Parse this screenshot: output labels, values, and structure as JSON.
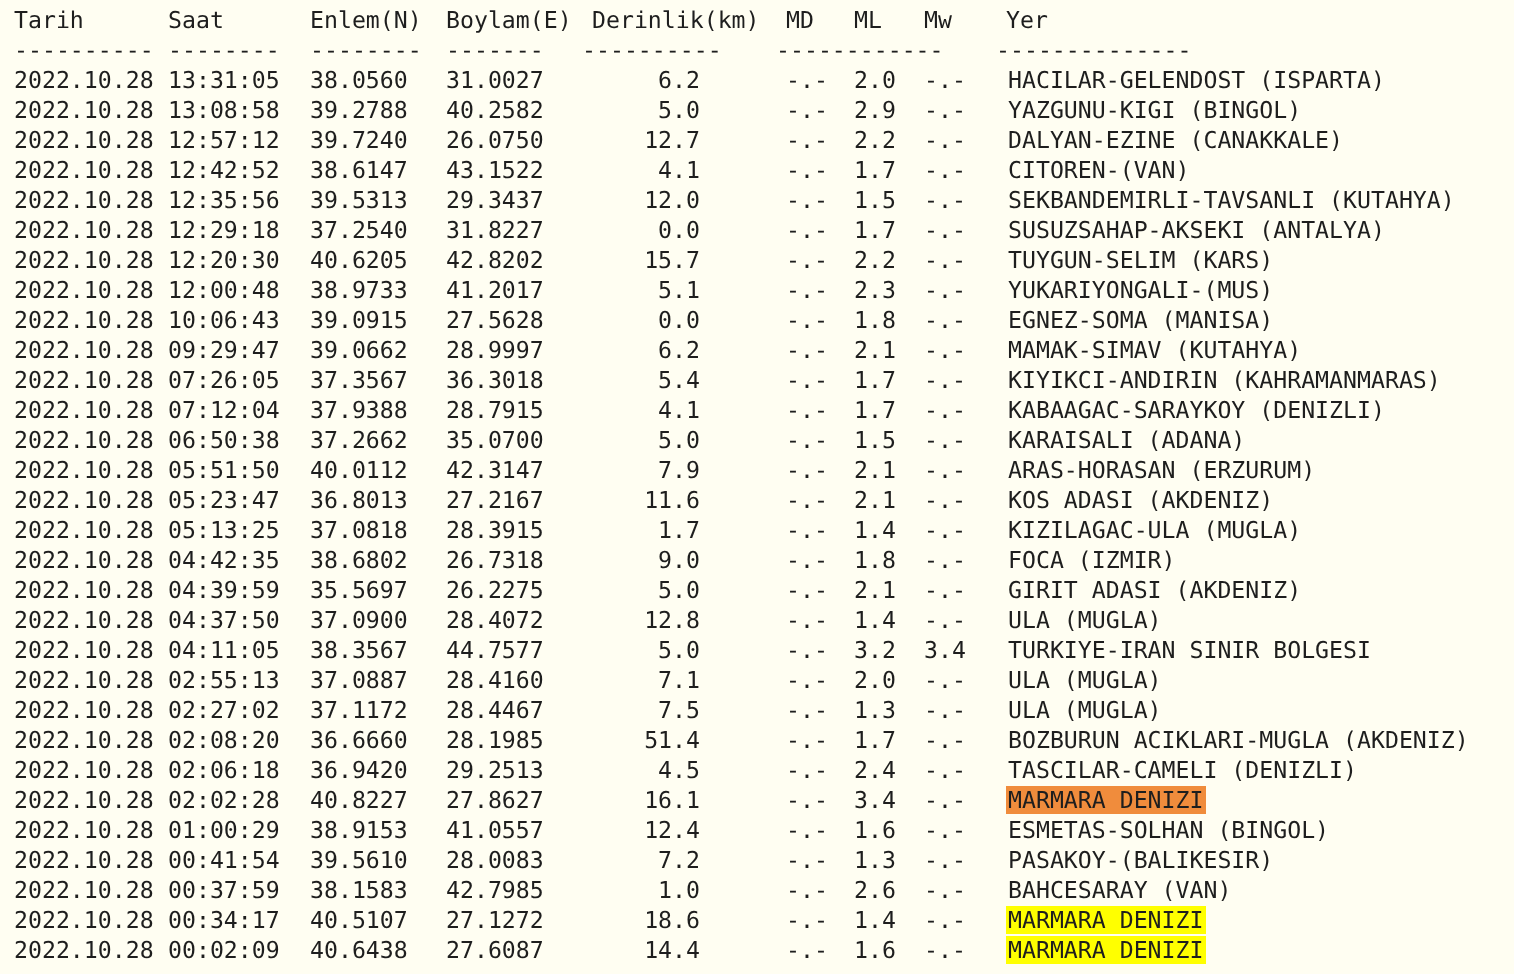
{
  "header": {
    "columns": [
      "Tarih",
      "Saat",
      "Enlem(N)",
      "Boylam(E)",
      "Derinlik(km)",
      "MD",
      "ML",
      "Mw",
      "Yer"
    ],
    "rules": [
      "----------",
      "--------",
      "--------",
      "-------",
      "----------",
      "------------",
      "--------------"
    ]
  },
  "rows": [
    {
      "date": "2022.10.28",
      "time": "13:31:05",
      "lat": "38.0560",
      "lon": "31.0027",
      "depth": "6.2",
      "md": "-.-",
      "ml": "2.0",
      "mw": "-.-",
      "location": "HACILAR-GELENDOST (ISPARTA)"
    },
    {
      "date": "2022.10.28",
      "time": "13:08:58",
      "lat": "39.2788",
      "lon": "40.2582",
      "depth": "5.0",
      "md": "-.-",
      "ml": "2.9",
      "mw": "-.-",
      "location": "YAZGUNU-KIGI (BINGOL)"
    },
    {
      "date": "2022.10.28",
      "time": "12:57:12",
      "lat": "39.7240",
      "lon": "26.0750",
      "depth": "12.7",
      "md": "-.-",
      "ml": "2.2",
      "mw": "-.-",
      "location": "DALYAN-EZINE (CANAKKALE)"
    },
    {
      "date": "2022.10.28",
      "time": "12:42:52",
      "lat": "38.6147",
      "lon": "43.1522",
      "depth": "4.1",
      "md": "-.-",
      "ml": "1.7",
      "mw": "-.-",
      "location": "CITOREN-(VAN)"
    },
    {
      "date": "2022.10.28",
      "time": "12:35:56",
      "lat": "39.5313",
      "lon": "29.3437",
      "depth": "12.0",
      "md": "-.-",
      "ml": "1.5",
      "mw": "-.-",
      "location": "SEKBANDEMIRLI-TAVSANLI (KUTAHYA)"
    },
    {
      "date": "2022.10.28",
      "time": "12:29:18",
      "lat": "37.2540",
      "lon": "31.8227",
      "depth": "0.0",
      "md": "-.-",
      "ml": "1.7",
      "mw": "-.-",
      "location": "SUSUZSAHAP-AKSEKI (ANTALYA)"
    },
    {
      "date": "2022.10.28",
      "time": "12:20:30",
      "lat": "40.6205",
      "lon": "42.8202",
      "depth": "15.7",
      "md": "-.-",
      "ml": "2.2",
      "mw": "-.-",
      "location": "TUYGUN-SELIM (KARS)"
    },
    {
      "date": "2022.10.28",
      "time": "12:00:48",
      "lat": "38.9733",
      "lon": "41.2017",
      "depth": "5.1",
      "md": "-.-",
      "ml": "2.3",
      "mw": "-.-",
      "location": "YUKARIYONGALI-(MUS)"
    },
    {
      "date": "2022.10.28",
      "time": "10:06:43",
      "lat": "39.0915",
      "lon": "27.5628",
      "depth": "0.0",
      "md": "-.-",
      "ml": "1.8",
      "mw": "-.-",
      "location": "EGNEZ-SOMA (MANISA)"
    },
    {
      "date": "2022.10.28",
      "time": "09:29:47",
      "lat": "39.0662",
      "lon": "28.9997",
      "depth": "6.2",
      "md": "-.-",
      "ml": "2.1",
      "mw": "-.-",
      "location": "MAMAK-SIMAV (KUTAHYA)"
    },
    {
      "date": "2022.10.28",
      "time": "07:26:05",
      "lat": "37.3567",
      "lon": "36.3018",
      "depth": "5.4",
      "md": "-.-",
      "ml": "1.7",
      "mw": "-.-",
      "location": "KIYIKCI-ANDIRIN (KAHRAMANMARAS)"
    },
    {
      "date": "2022.10.28",
      "time": "07:12:04",
      "lat": "37.9388",
      "lon": "28.7915",
      "depth": "4.1",
      "md": "-.-",
      "ml": "1.7",
      "mw": "-.-",
      "location": "KABAAGAC-SARAYKOY (DENIZLI)"
    },
    {
      "date": "2022.10.28",
      "time": "06:50:38",
      "lat": "37.2662",
      "lon": "35.0700",
      "depth": "5.0",
      "md": "-.-",
      "ml": "1.5",
      "mw": "-.-",
      "location": "KARAISALI (ADANA)"
    },
    {
      "date": "2022.10.28",
      "time": "05:51:50",
      "lat": "40.0112",
      "lon": "42.3147",
      "depth": "7.9",
      "md": "-.-",
      "ml": "2.1",
      "mw": "-.-",
      "location": "ARAS-HORASAN (ERZURUM)"
    },
    {
      "date": "2022.10.28",
      "time": "05:23:47",
      "lat": "36.8013",
      "lon": "27.2167",
      "depth": "11.6",
      "md": "-.-",
      "ml": "2.1",
      "mw": "-.-",
      "location": "KOS ADASI (AKDENIZ)"
    },
    {
      "date": "2022.10.28",
      "time": "05:13:25",
      "lat": "37.0818",
      "lon": "28.3915",
      "depth": "1.7",
      "md": "-.-",
      "ml": "1.4",
      "mw": "-.-",
      "location": "KIZILAGAC-ULA (MUGLA)"
    },
    {
      "date": "2022.10.28",
      "time": "04:42:35",
      "lat": "38.6802",
      "lon": "26.7318",
      "depth": "9.0",
      "md": "-.-",
      "ml": "1.8",
      "mw": "-.-",
      "location": "FOCA (IZMIR)"
    },
    {
      "date": "2022.10.28",
      "time": "04:39:59",
      "lat": "35.5697",
      "lon": "26.2275",
      "depth": "5.0",
      "md": "-.-",
      "ml": "2.1",
      "mw": "-.-",
      "location": "GIRIT ADASI (AKDENIZ)"
    },
    {
      "date": "2022.10.28",
      "time": "04:37:50",
      "lat": "37.0900",
      "lon": "28.4072",
      "depth": "12.8",
      "md": "-.-",
      "ml": "1.4",
      "mw": "-.-",
      "location": "ULA (MUGLA)"
    },
    {
      "date": "2022.10.28",
      "time": "04:11:05",
      "lat": "38.3567",
      "lon": "44.7577",
      "depth": "5.0",
      "md": "-.-",
      "ml": "3.2",
      "mw": "3.4",
      "location": "TURKIYE-IRAN SINIR BOLGESI"
    },
    {
      "date": "2022.10.28",
      "time": "02:55:13",
      "lat": "37.0887",
      "lon": "28.4160",
      "depth": "7.1",
      "md": "-.-",
      "ml": "2.0",
      "mw": "-.-",
      "location": "ULA (MUGLA)"
    },
    {
      "date": "2022.10.28",
      "time": "02:27:02",
      "lat": "37.1172",
      "lon": "28.4467",
      "depth": "7.5",
      "md": "-.-",
      "ml": "1.3",
      "mw": "-.-",
      "location": "ULA (MUGLA)"
    },
    {
      "date": "2022.10.28",
      "time": "02:08:20",
      "lat": "36.6660",
      "lon": "28.1985",
      "depth": "51.4",
      "md": "-.-",
      "ml": "1.7",
      "mw": "-.-",
      "location": "BOZBURUN ACIKLARI-MUGLA (AKDENIZ)"
    },
    {
      "date": "2022.10.28",
      "time": "02:06:18",
      "lat": "36.9420",
      "lon": "29.2513",
      "depth": "4.5",
      "md": "-.-",
      "ml": "2.4",
      "mw": "-.-",
      "location": "TASCILAR-CAMELI (DENIZLI)"
    },
    {
      "date": "2022.10.28",
      "time": "02:02:28",
      "lat": "40.8227",
      "lon": "27.8627",
      "depth": "16.1",
      "md": "-.-",
      "ml": "3.4",
      "mw": "-.-",
      "location": "MARMARA DENIZI",
      "color": "#f08c3c"
    },
    {
      "date": "2022.10.28",
      "time": "01:00:29",
      "lat": "38.9153",
      "lon": "41.0557",
      "depth": "12.4",
      "md": "-.-",
      "ml": "1.6",
      "mw": "-.-",
      "location": "ESMETAS-SOLHAN (BINGOL)"
    },
    {
      "date": "2022.10.28",
      "time": "00:41:54",
      "lat": "39.5610",
      "lon": "28.0083",
      "depth": "7.2",
      "md": "-.-",
      "ml": "1.3",
      "mw": "-.-",
      "location": "PASAKOY-(BALIKESIR)"
    },
    {
      "date": "2022.10.28",
      "time": "00:37:59",
      "lat": "38.1583",
      "lon": "42.7985",
      "depth": "1.0",
      "md": "-.-",
      "ml": "2.6",
      "mw": "-.-",
      "location": "BAHCESARAY (VAN)"
    },
    {
      "date": "2022.10.28",
      "time": "00:34:17",
      "lat": "40.5107",
      "lon": "27.1272",
      "depth": "18.6",
      "md": "-.-",
      "ml": "1.4",
      "mw": "-.-",
      "location": "MARMARA DENIZI",
      "color": "#ffff00"
    },
    {
      "date": "2022.10.28",
      "time": "00:02:09",
      "lat": "40.6438",
      "lon": "27.6087",
      "depth": "14.4",
      "md": "-.-",
      "ml": "1.6",
      "mw": "-.-",
      "location": "MARMARA DENIZI",
      "color": "#ffff00"
    }
  ]
}
